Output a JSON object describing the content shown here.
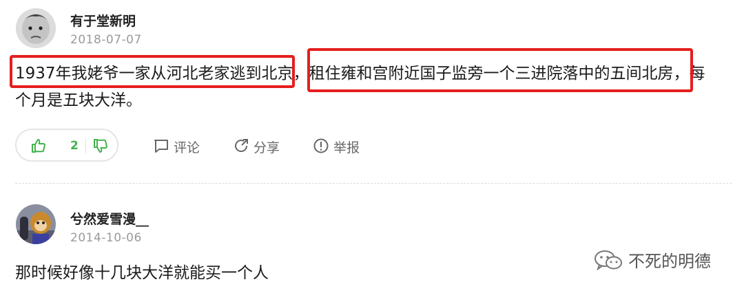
{
  "comments": [
    {
      "username": "有于堂新明",
      "date": "2018-07-07",
      "text_line1": "1937年我姥爷一家从河北老家逃到北京，租住雍和宫附近国子监旁一个三进院落中的五间北房，每",
      "text_line2": "个月是五块大洋。",
      "likes": "2",
      "actions": {
        "comment": "评论",
        "share": "分享",
        "report": "举报"
      }
    },
    {
      "username": "兮然爱雪漫__",
      "date": "2014-10-06",
      "text": "那时候好像十几块大洋就能买一个人"
    }
  ],
  "watermark": "不死的明德",
  "colors": {
    "highlight": "#e41e1e",
    "like": "#40b14b"
  }
}
